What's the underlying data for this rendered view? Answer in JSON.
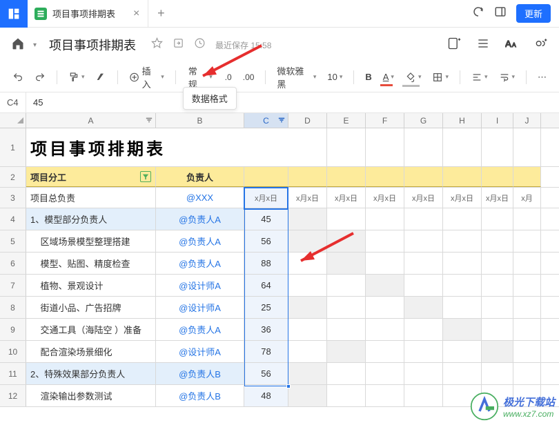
{
  "titlebar": {
    "tab_title": "项目事项排期表",
    "update_btn": "更新"
  },
  "doc_header": {
    "title": "项目事项排期表",
    "saved": "最近保存 15:58"
  },
  "toolbar": {
    "insert": "插入",
    "format": "常规",
    "format_tooltip": "数据格式",
    "decimals": ".0",
    "decimals_inc": ".00",
    "font_name": "微软雅黑",
    "font_size": "10"
  },
  "formula": {
    "cell": "C4",
    "value": "45"
  },
  "columns": [
    "A",
    "B",
    "C",
    "D",
    "E",
    "F",
    "G",
    "H",
    "I",
    "J"
  ],
  "rows": [
    "1",
    "2",
    "3",
    "4",
    "5",
    "6",
    "7",
    "8",
    "9",
    "10",
    "11",
    "12"
  ],
  "sheet": {
    "title": "项目事项排期表",
    "header_a": "项目分工",
    "header_b": "负责人",
    "row3": {
      "a": "项目总负责",
      "b": "@XXX",
      "date": "x月x日"
    },
    "data": [
      {
        "a": "1、模型部分负责人",
        "b": "@负责人A",
        "c": "45"
      },
      {
        "a": "区域场景模型整理搭建",
        "b": "@负责人A",
        "c": "56"
      },
      {
        "a": "模型、贴图、精度检查",
        "b": "@负责人A",
        "c": "88"
      },
      {
        "a": "植物、景观设计",
        "b": "@设计师A",
        "c": "64"
      },
      {
        "a": "街道小品、广告招牌",
        "b": "@设计师A",
        "c": "25"
      },
      {
        "a": "交通工具（海陆空 ）准备",
        "b": "@负责人A",
        "c": "36"
      },
      {
        "a": "配合渲染场景细化",
        "b": "@设计师A",
        "c": "78"
      },
      {
        "a": "2、特殊效果部分负责人",
        "b": "@负责人B",
        "c": "56"
      },
      {
        "a": "渲染输出参数测试",
        "b": "@负责人B",
        "c": "48"
      }
    ]
  },
  "watermark": {
    "l1": "极光下载站",
    "l2": "www.xz7.com"
  }
}
